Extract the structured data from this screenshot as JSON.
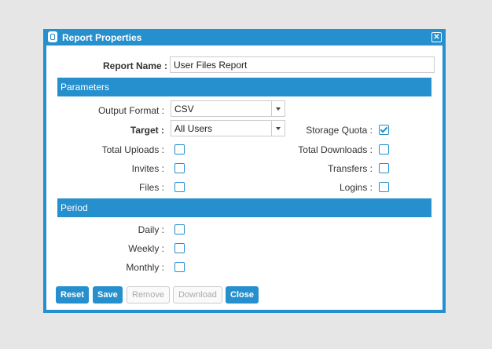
{
  "title": "Report Properties",
  "report_name": {
    "label": "Report Name :",
    "value": "User Files Report"
  },
  "parameters": {
    "header": "Parameters",
    "output_format": {
      "label": "Output Format :",
      "value": "CSV"
    },
    "target": {
      "label": "Target :",
      "value": "All Users"
    },
    "storage_quota": {
      "label": "Storage Quota :",
      "checked": true
    },
    "total_uploads": {
      "label": "Total Uploads :",
      "checked": false
    },
    "total_downloads": {
      "label": "Total Downloads :",
      "checked": false
    },
    "invites": {
      "label": "Invites :",
      "checked": false
    },
    "transfers": {
      "label": "Transfers :",
      "checked": false
    },
    "files": {
      "label": "Files :",
      "checked": false
    },
    "logins": {
      "label": "Logins :",
      "checked": false
    }
  },
  "period": {
    "header": "Period",
    "daily": "Daily :",
    "weekly": "Weekly :",
    "monthly": "Monthly :"
  },
  "buttons": {
    "reset": "Reset",
    "save": "Save",
    "remove": "Remove",
    "download": "Download",
    "close": "Close"
  },
  "accent": "#268fcd"
}
